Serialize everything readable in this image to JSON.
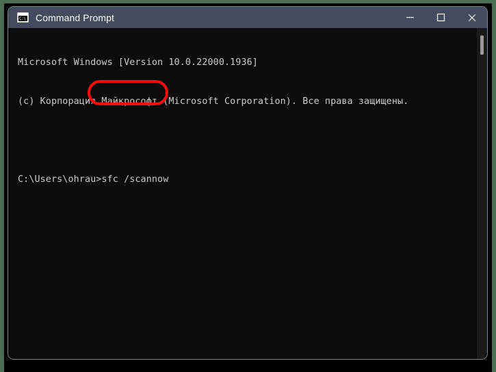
{
  "window": {
    "title": "Command Prompt",
    "icon_name": "cmd-icon",
    "icon_text": "C:\\_",
    "controls": [
      {
        "name": "minimize-button",
        "glyph": "minimize",
        "label": "Minimize"
      },
      {
        "name": "maximize-button",
        "glyph": "maximize",
        "label": "Maximize"
      },
      {
        "name": "close-button",
        "glyph": "close",
        "label": "Close"
      }
    ]
  },
  "console": {
    "lines": [
      "Microsoft Windows [Version 10.0.22000.1936]",
      "(c) Корпорация Майкрософт (Microsoft Corporation). Все права защищены.",
      "",
      "C:\\Users\\ohrau>sfc /scannow"
    ],
    "prompt_path": "C:\\Users\\ohrau",
    "command": "sfc /scannow",
    "os_version": "10.0.22000.1936"
  },
  "annotation": {
    "name": "red-highlight-box",
    "target_text": ">sfc /scannow",
    "color": "#f50d0d"
  },
  "colors": {
    "title_bar": "#434b5e",
    "console_background": "#0c0c0c",
    "console_text": "#cccccc",
    "wallpaper": "#4c6e55",
    "scrollbar_thumb": "#9a9a9a",
    "annotation": "#f50d0d"
  }
}
